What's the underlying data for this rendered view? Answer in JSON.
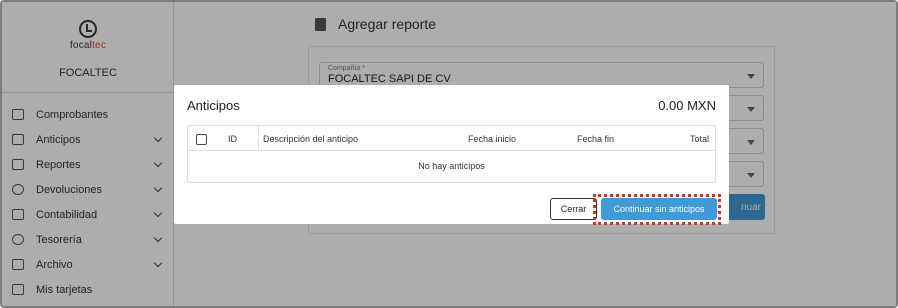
{
  "sidebar": {
    "logo_text_a": "focal",
    "logo_text_b": "tec",
    "company": "FOCALTEC",
    "items": [
      {
        "label": "Comprobantes",
        "icon": "receipt-icon",
        "expandable": false
      },
      {
        "label": "Anticipos",
        "icon": "money-icon",
        "expandable": true
      },
      {
        "label": "Reportes",
        "icon": "document-icon",
        "expandable": true
      },
      {
        "label": "Devoluciones",
        "icon": "refund-icon",
        "expandable": true
      },
      {
        "label": "Contabilidad",
        "icon": "bank-icon",
        "expandable": true
      },
      {
        "label": "Tesorería",
        "icon": "piggy-bank-icon",
        "expandable": true
      },
      {
        "label": "Archivo",
        "icon": "archive-icon",
        "expandable": true
      },
      {
        "label": "Mis tarjetas",
        "icon": "card-icon",
        "expandable": false
      }
    ]
  },
  "main": {
    "page_title": "Agregar reporte",
    "form": {
      "company_label": "Compañía *",
      "company_value": "FOCALTEC SAPI DE CV",
      "partial_button": "nuar"
    }
  },
  "modal": {
    "title": "Anticipos",
    "total": "0.00 MXN",
    "columns": [
      "ID",
      "Descripción del anticipo",
      "Fecha inicio",
      "Fecha fin",
      "Total"
    ],
    "empty_text": "No hay anticipos",
    "close_label": "Cerrar",
    "continue_label": "Continuar sin anticipos"
  },
  "colors": {
    "primary": "#3e9ad8",
    "highlight": "#d7312b",
    "logo_accent": "#e0463a"
  }
}
